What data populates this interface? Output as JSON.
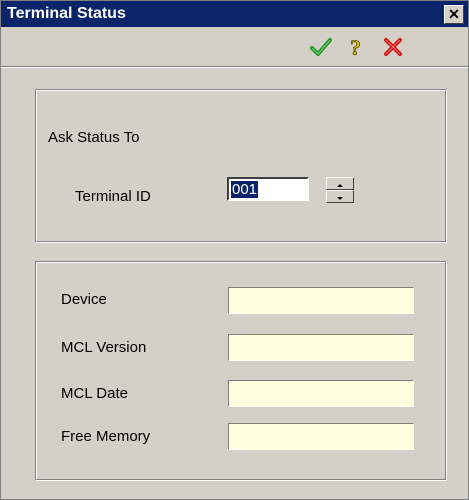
{
  "window": {
    "title": "Terminal Status"
  },
  "toolbar": {
    "ok_icon": "checkmark-icon",
    "help_icon": "question-mark-icon",
    "cancel_icon": "red-x-icon",
    "colors": {
      "ok": "#1f8f1f",
      "help": "#d4c000",
      "cancel": "#d01010"
    }
  },
  "ask_status": {
    "heading": "Ask Status To",
    "terminal_id_label": "Terminal ID",
    "terminal_id_value": "001"
  },
  "status": {
    "device_label": "Device",
    "device_value": "",
    "mcl_version_label": "MCL Version",
    "mcl_version_value": "",
    "mcl_date_label": "MCL Date",
    "mcl_date_value": "",
    "free_memory_label": "Free Memory",
    "free_memory_value": ""
  }
}
